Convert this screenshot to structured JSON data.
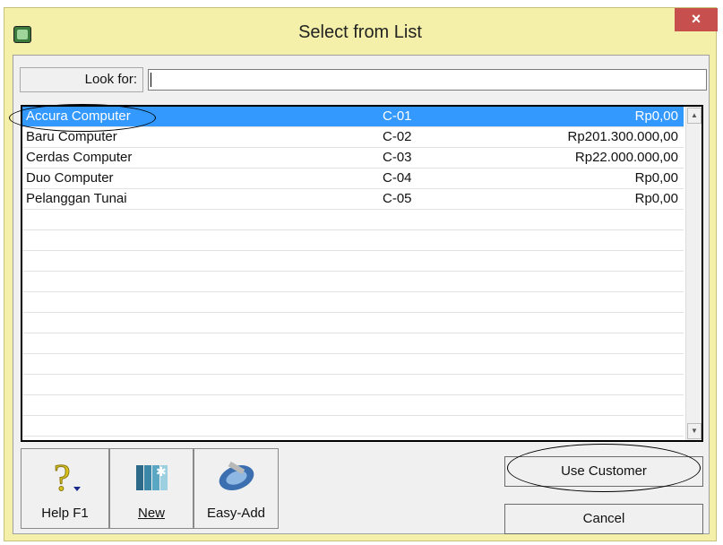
{
  "window": {
    "title": "Select from List",
    "close_label": "×"
  },
  "search": {
    "label": "Look for:",
    "value": ""
  },
  "list": {
    "rows": [
      {
        "name": "Accura Computer",
        "code": "C-01",
        "balance": "Rp0,00"
      },
      {
        "name": "Baru Computer",
        "code": "C-02",
        "balance": "Rp201.300.000,00"
      },
      {
        "name": "Cerdas Computer",
        "code": "C-03",
        "balance": "Rp22.000.000,00"
      },
      {
        "name": "Duo Computer",
        "code": "C-04",
        "balance": "Rp0,00"
      },
      {
        "name": "Pelanggan Tunai",
        "code": "C-05",
        "balance": "Rp0,00"
      }
    ],
    "selected_index": 0
  },
  "toolbar": {
    "help_label": "Help F1",
    "new_label": "New",
    "easyadd_label": "Easy-Add"
  },
  "actions": {
    "use_customer_label": "Use Customer",
    "cancel_label": "Cancel"
  },
  "icons": {
    "help": "question-icon",
    "new": "new-record-icon",
    "easyadd": "easy-add-icon",
    "app": "app-icon",
    "close": "close-icon"
  },
  "colors": {
    "window_bg": "#f5f0a9",
    "selection": "#3399ff",
    "close": "#c7504f"
  }
}
